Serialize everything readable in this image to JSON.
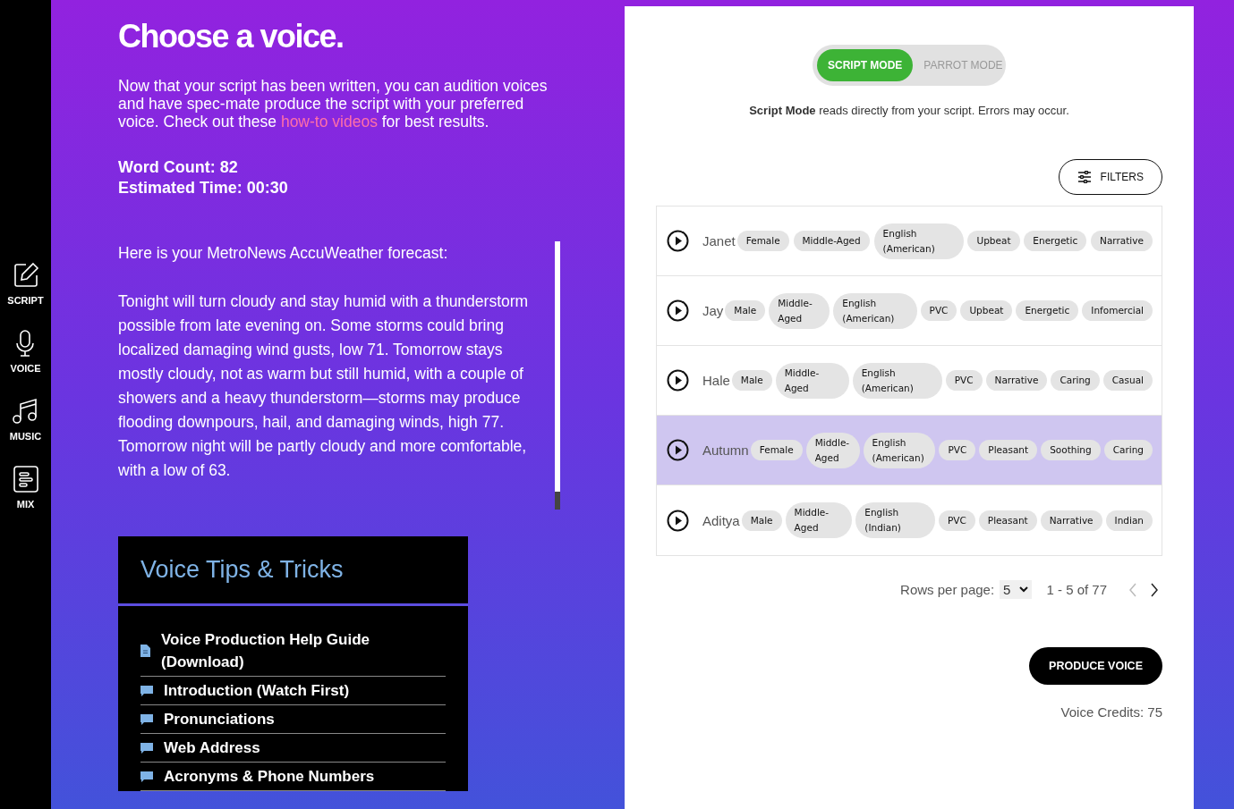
{
  "sidebar": {
    "items": [
      {
        "label": "SCRIPT"
      },
      {
        "label": "VOICE"
      },
      {
        "label": "MUSIC"
      },
      {
        "label": "MIX"
      }
    ]
  },
  "intro": {
    "title": "Choose a voice.",
    "description_before": "Now that your script has been written, you can audition voices and have spec-mate produce the script with your preferred voice. Check out these",
    "link": "how-to videos",
    "description_after": "for best results.",
    "word_count": "Word Count: 82",
    "estimated_time": "Estimated Time: 00:30"
  },
  "script": {
    "paragraphs": [
      "Here is your MetroNews AccuWeather forecast:",
      "Tonight will turn cloudy and stay humid with a thunderstorm possible from late evening on. Some storms could bring localized damaging wind gusts, low 71. Tomorrow stays mostly cloudy, not as warm but still humid, with a couple of showers and a heavy thunderstorm—storms may produce flooding downpours, hail, and damaging winds, high 77. Tomorrow night will be partly cloudy and more comfortable, with a low of 63."
    ]
  },
  "tips": {
    "title": "Voice Tips & Tricks",
    "items": [
      {
        "label": "Voice Production Help Guide (Download)",
        "kind": "download"
      },
      {
        "label": "Introduction (Watch First)",
        "kind": "video"
      },
      {
        "label": "Pronunciations",
        "kind": "video"
      },
      {
        "label": "Web Address",
        "kind": "video"
      },
      {
        "label": "Acronyms & Phone Numbers",
        "kind": "video"
      }
    ]
  },
  "modes": [
    {
      "label": "SCRIPT MODE",
      "selected": true
    },
    {
      "label": "PARROT MODE",
      "selected": false
    }
  ],
  "mode_description": "**Script Mode** reads directly from your script. Errors may occur.",
  "filters_button": "FILTERS",
  "voices": [
    {
      "name": "Janet",
      "selected": false,
      "tags": [
        "Female",
        "Middle-Aged",
        "English (American)",
        "Upbeat",
        "Energetic",
        "Narrative"
      ]
    },
    {
      "name": "Jay",
      "selected": false,
      "tags": [
        "Male",
        "Middle-Aged",
        "English (American)",
        "PVC",
        "Upbeat",
        "Energetic",
        "Infomercial"
      ]
    },
    {
      "name": "Hale",
      "selected": false,
      "tags": [
        "Male",
        "Middle-Aged",
        "English (American)",
        "PVC",
        "Narrative",
        "Caring",
        "Casual"
      ]
    },
    {
      "name": "Autumn",
      "selected": true,
      "tags": [
        "Female",
        "Middle-Aged",
        "English (American)",
        "PVC",
        "Pleasant",
        "Soothing",
        "Caring"
      ]
    },
    {
      "name": "Aditya",
      "selected": false,
      "tags": [
        "Male",
        "Middle-Aged",
        "English (Indian)",
        "PVC",
        "Pleasant",
        "Narrative",
        "Indian"
      ]
    }
  ],
  "pagination": {
    "rows_label": "Rows per page:",
    "rows_value": "5",
    "range": "1 - 5 of 77",
    "prev_disabled": true,
    "next_disabled": false
  },
  "produce_button": "PRODUCE VOICE",
  "credits": "Voice Credits: 75"
}
